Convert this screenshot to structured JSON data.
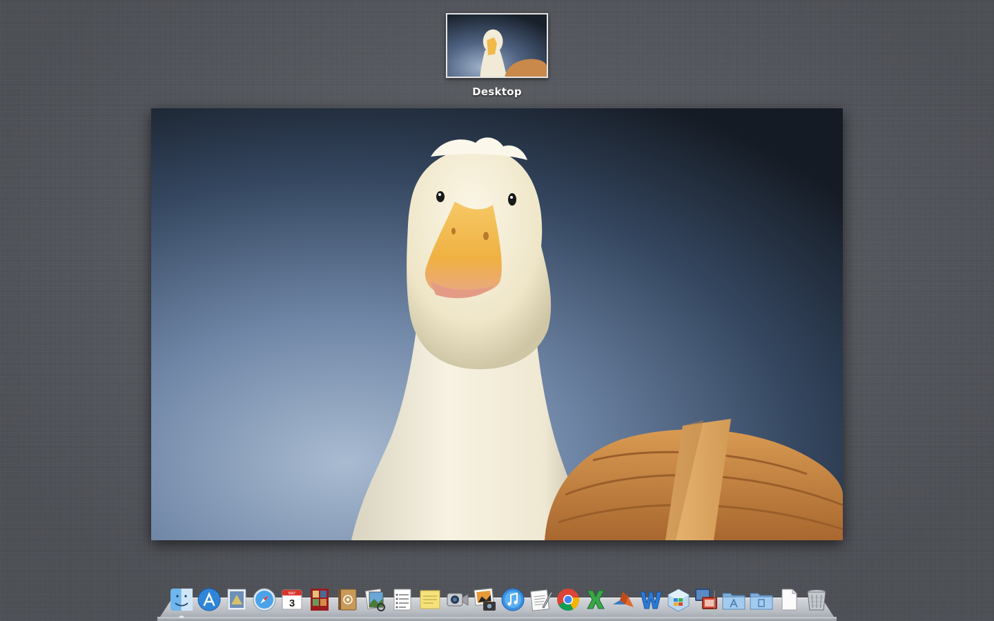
{
  "mission_control": {
    "spaces": [
      {
        "label": "Desktop",
        "selected": true
      }
    ]
  },
  "dock": {
    "apps": [
      {
        "name": "finder",
        "icon": "finder-icon",
        "running": true
      },
      {
        "name": "app-store",
        "icon": "app-store-icon",
        "running": false
      },
      {
        "name": "mail",
        "icon": "mail-stamp-icon",
        "running": false
      },
      {
        "name": "safari",
        "icon": "safari-compass-icon",
        "running": false
      },
      {
        "name": "ical",
        "icon": "calendar-icon",
        "running": false,
        "calendar_day": "3",
        "calendar_month": "MAY"
      },
      {
        "name": "photo-booth",
        "icon": "photo-booth-icon",
        "running": false
      },
      {
        "name": "address-book",
        "icon": "address-book-icon",
        "running": false
      },
      {
        "name": "preview",
        "icon": "preview-icon",
        "running": false
      },
      {
        "name": "reminders",
        "icon": "reminders-icon",
        "running": false
      },
      {
        "name": "stickies",
        "icon": "notes-icon",
        "running": false
      },
      {
        "name": "facetime",
        "icon": "facetime-camera-icon",
        "running": false
      },
      {
        "name": "iphoto",
        "icon": "iphoto-icon",
        "running": false
      },
      {
        "name": "itunes",
        "icon": "itunes-icon",
        "running": false
      },
      {
        "name": "textedit",
        "icon": "textedit-icon",
        "running": false
      },
      {
        "name": "chrome",
        "icon": "chrome-icon",
        "running": false
      },
      {
        "name": "excel",
        "icon": "excel-icon",
        "running": false
      },
      {
        "name": "matlab",
        "icon": "matlab-icon",
        "running": false
      },
      {
        "name": "word",
        "icon": "word-icon",
        "running": false
      },
      {
        "name": "windows-vm",
        "icon": "windows-vm-icon",
        "running": false
      },
      {
        "name": "remote-desktop",
        "icon": "remote-desktop-icon",
        "running": false
      }
    ],
    "stacks": [
      {
        "name": "applications",
        "icon": "applications-folder-icon"
      },
      {
        "name": "documents",
        "icon": "documents-folder-icon"
      },
      {
        "name": "downloads",
        "icon": "document-file-icon"
      },
      {
        "name": "trash",
        "icon": "trash-icon"
      }
    ]
  },
  "colors": {
    "background": "#55585e",
    "wallpaper_sky_top": "#1f2a38",
    "wallpaper_sky_bottom": "#8fa3bd",
    "duck_feathers": "#f3ecd6",
    "duck_beak": "#f0b94a",
    "basket": "#c8894a"
  }
}
